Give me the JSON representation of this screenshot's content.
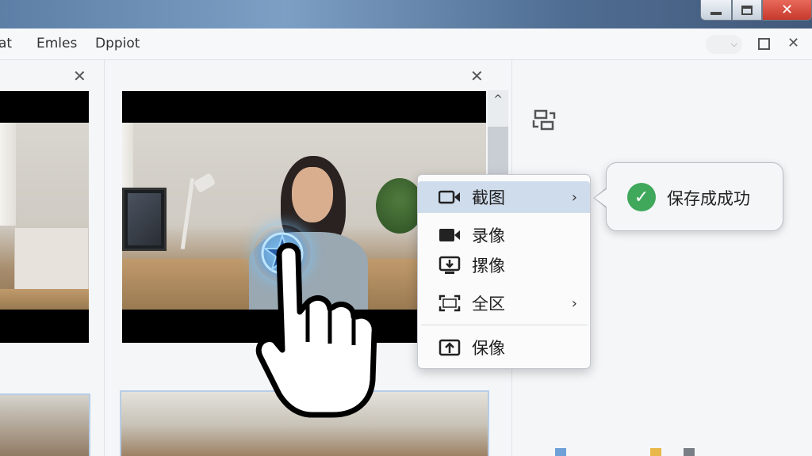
{
  "menubar": {
    "items": [
      "at",
      "Emles",
      "Dppiot"
    ]
  },
  "window_controls": {
    "minimize_icon": "minimize-icon",
    "maximize_icon": "maximize-icon",
    "close_icon": "close-icon"
  },
  "pane": {
    "scroll_up_glyph": "^"
  },
  "context_menu": {
    "items": [
      {
        "label": "截图",
        "icon": "camera-icon",
        "has_submenu": true,
        "highlighted": true
      },
      {
        "label": "录像",
        "icon": "video-icon",
        "has_submenu": false
      },
      {
        "label": "摞像",
        "icon": "screen-download-icon",
        "has_submenu": false
      },
      {
        "label": "全区",
        "icon": "fullscreen-icon",
        "has_submenu": true
      },
      {
        "label": "保像",
        "icon": "upload-icon",
        "has_submenu": false
      }
    ],
    "submenu_glyph": "›"
  },
  "toast": {
    "message": "保存成成功",
    "status_color": "#3fa85b"
  },
  "colors": {
    "highlight": "#cfdcec",
    "ripple": "#46a0f0",
    "close_button": "#c63a2c"
  }
}
